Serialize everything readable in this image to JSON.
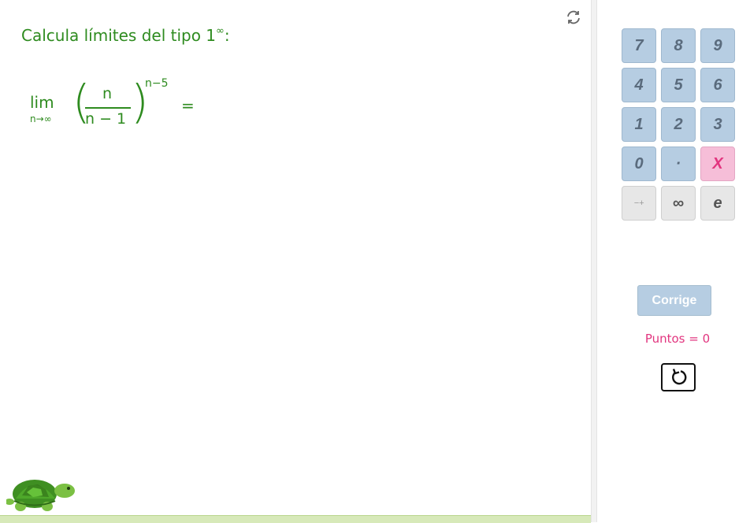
{
  "exercise": {
    "prompt_text": "Calcula límites del tipo 1",
    "prompt_sup": "∞",
    "prompt_suffix": ":",
    "lim_word": "lim",
    "lim_sub": "n→∞",
    "numerator": "n",
    "denominator": "n − 1",
    "exponent": "n−5",
    "equals": "="
  },
  "keypad": {
    "rows": [
      [
        "7",
        "8",
        "9"
      ],
      [
        "4",
        "5",
        "6"
      ],
      [
        "1",
        "2",
        "3"
      ],
      [
        "0",
        "·",
        "X"
      ],
      [
        "−+",
        "∞",
        "e"
      ]
    ]
  },
  "actions": {
    "check_label": "Corrige",
    "score_text": "Puntos = 0"
  },
  "colors": {
    "math_green": "#2e8b1f",
    "key_blue": "#b6cde2",
    "key_pink": "#f6bed8",
    "score_pink": "#e2357f"
  },
  "icons": [
    "refresh-icon",
    "reset-icon",
    "turtle-logo"
  ]
}
